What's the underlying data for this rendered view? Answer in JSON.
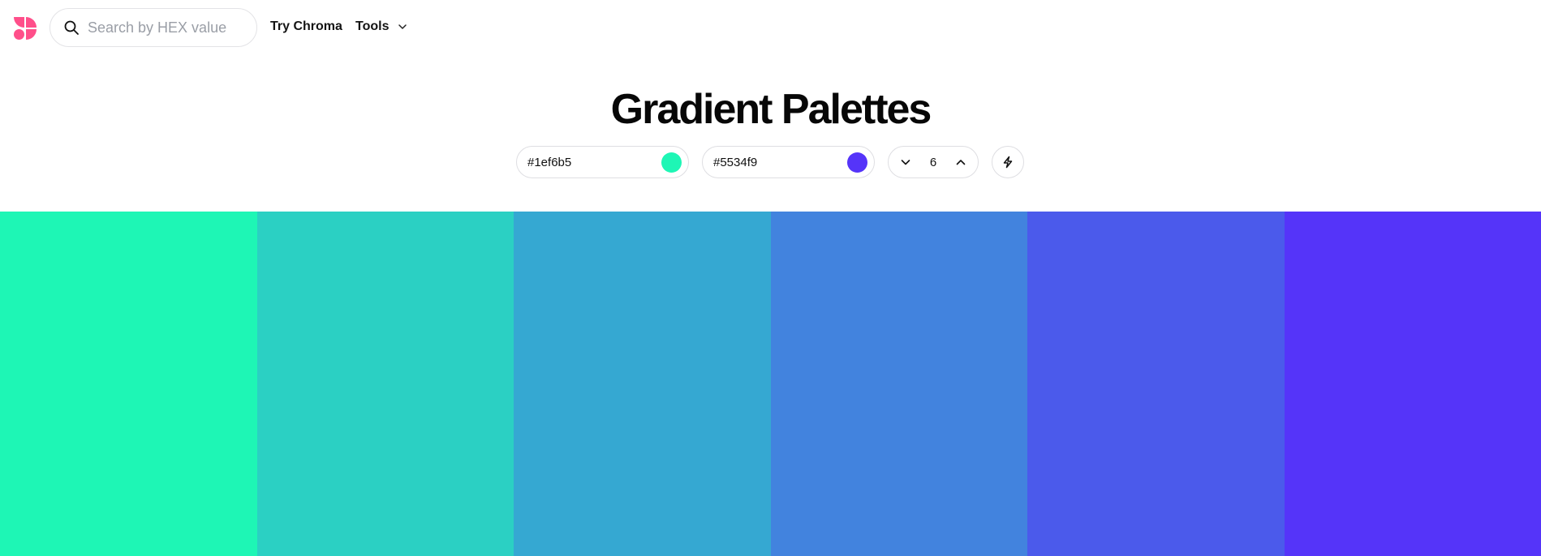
{
  "nav": {
    "logo_color": "#ff4f8a",
    "search_placeholder": "Search by HEX value",
    "search_value": "",
    "links": [
      {
        "label": "Try Chroma"
      },
      {
        "label": "Tools"
      }
    ]
  },
  "page": {
    "title": "Gradient Palettes"
  },
  "controls": {
    "start_color": {
      "value": "#1ef6b5",
      "swatch": "#1ef6b5"
    },
    "end_color": {
      "value": "#5534f9",
      "swatch": "#5534f9"
    },
    "steps": "6",
    "decrease_icon": "chevron-down-icon",
    "increase_icon": "chevron-up-icon",
    "action_icon": "lightning-bolt-icon"
  },
  "palette": {
    "colors": [
      "#1ef6b5",
      "#2bd0c3",
      "#35a8d2",
      "#4283de",
      "#4b5aeb",
      "#5534f9"
    ]
  }
}
